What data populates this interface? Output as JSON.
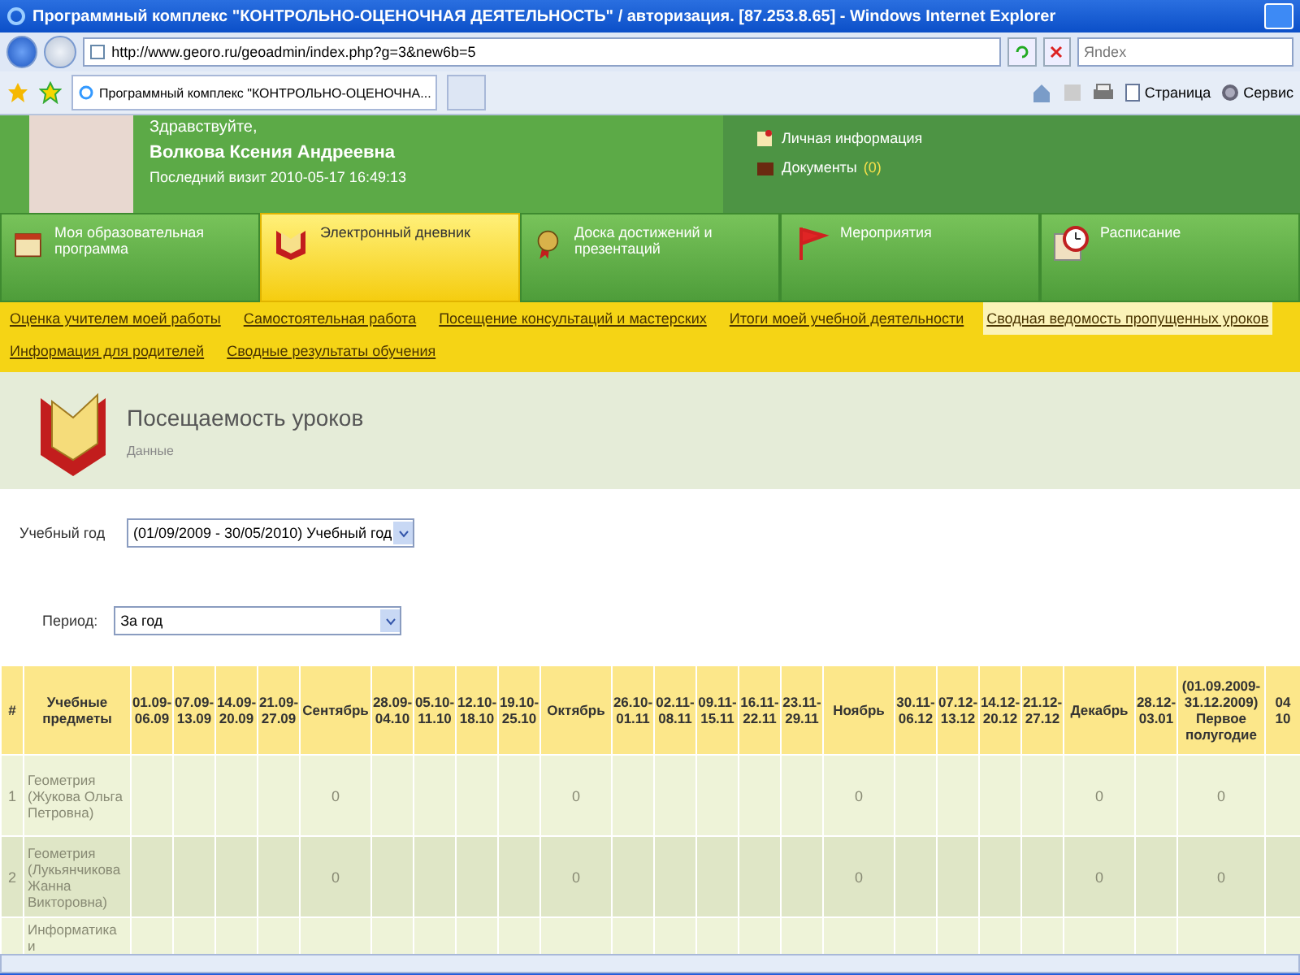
{
  "window": {
    "title": "Программный комплекс \"КОНТРОЛЬНО-ОЦЕНОЧНАЯ ДЕЯТЕЛЬНОСТЬ\" / авторизация. [87.253.8.65] - Windows Internet Explorer"
  },
  "browser": {
    "address": "http://www.georo.ru/geoadmin/index.php?g=3&new6b=5",
    "search_placeholder": "Яndex",
    "tab_title": "Программный комплекс \"КОНТРОЛЬНО-ОЦЕНОЧНА...",
    "toolbar": [
      "Страница",
      "Сервис"
    ]
  },
  "header": {
    "greeting": "Здравствуйте,",
    "name": "Волкова Ксения Андреевна",
    "last_visit": "Последний визит 2010-05-17 16:49:13",
    "links": [
      {
        "label": "Личная информация",
        "kind": "profile"
      },
      {
        "label": "Документы",
        "count": "(0)",
        "kind": "documents"
      }
    ]
  },
  "tabs": [
    {
      "label": "Моя образовательная программа",
      "selected": false
    },
    {
      "label": "Электронный дневник",
      "selected": true
    },
    {
      "label": "Доска достижений и презентаций",
      "selected": false
    },
    {
      "label": "Мероприятия",
      "selected": false
    },
    {
      "label": "Расписание",
      "selected": false
    }
  ],
  "subnav": [
    {
      "label": "Оценка учителем моей работы",
      "selected": false
    },
    {
      "label": "Самостоятельная работа",
      "selected": false
    },
    {
      "label": "Посещение консультаций и мастерских",
      "selected": false
    },
    {
      "label": "Итоги моей учебной деятельности",
      "selected": false
    },
    {
      "label": "Сводная ведомость пропущенных уроков",
      "selected": true
    },
    {
      "label": "Информация для родителей",
      "selected": false
    },
    {
      "label": "Сводные результаты обучения",
      "selected": false
    }
  ],
  "page": {
    "title": "Посещаемость уроков",
    "subtitle": "Данные"
  },
  "filters": [
    {
      "label": "Учебный год",
      "value": "(01/09/2009 - 30/05/2010) Учебный год"
    },
    {
      "label": "Период:",
      "value": "За год"
    }
  ],
  "table": {
    "columns": [
      "#",
      "Учебные предметы",
      "01.09- 06.09",
      "07.09- 13.09",
      "14.09- 20.09",
      "21.09- 27.09",
      "Сентябрь",
      "28.09- 04.10",
      "05.10- 11.10",
      "12.10- 18.10",
      "19.10- 25.10",
      "Октябрь",
      "26.10- 01.11",
      "02.11- 08.11",
      "09.11- 15.11",
      "16.11- 22.11",
      "23.11- 29.11",
      "Ноябрь",
      "30.11- 06.12",
      "07.12- 13.12",
      "14.12- 20.12",
      "21.12- 27.12",
      "Декабрь",
      "28.12- 03.01",
      "(01.09.2009- 31.12.2009) Первое полугодие",
      "04 10"
    ],
    "rows": [
      {
        "cells": [
          "1",
          "Геометрия (Жукова Ольга Петровна)",
          null,
          null,
          null,
          null,
          "0",
          null,
          null,
          null,
          null,
          "0",
          null,
          null,
          null,
          null,
          null,
          "0",
          null,
          null,
          null,
          null,
          "0",
          null,
          "0",
          null
        ]
      },
      {
        "cells": [
          "2",
          "Геометрия (Лукьянчикова Жанна Викторовна)",
          null,
          null,
          null,
          null,
          "0",
          null,
          null,
          null,
          null,
          "0",
          null,
          null,
          null,
          null,
          null,
          "0",
          null,
          null,
          null,
          null,
          "0",
          null,
          "0",
          null
        ]
      },
      {
        "cells": [
          null,
          "Информатика и",
          null,
          null,
          null,
          null,
          null,
          null,
          null,
          null,
          null,
          null,
          null,
          null,
          null,
          null,
          null,
          null,
          null,
          null,
          null,
          null,
          null,
          null,
          null,
          null
        ]
      }
    ]
  }
}
